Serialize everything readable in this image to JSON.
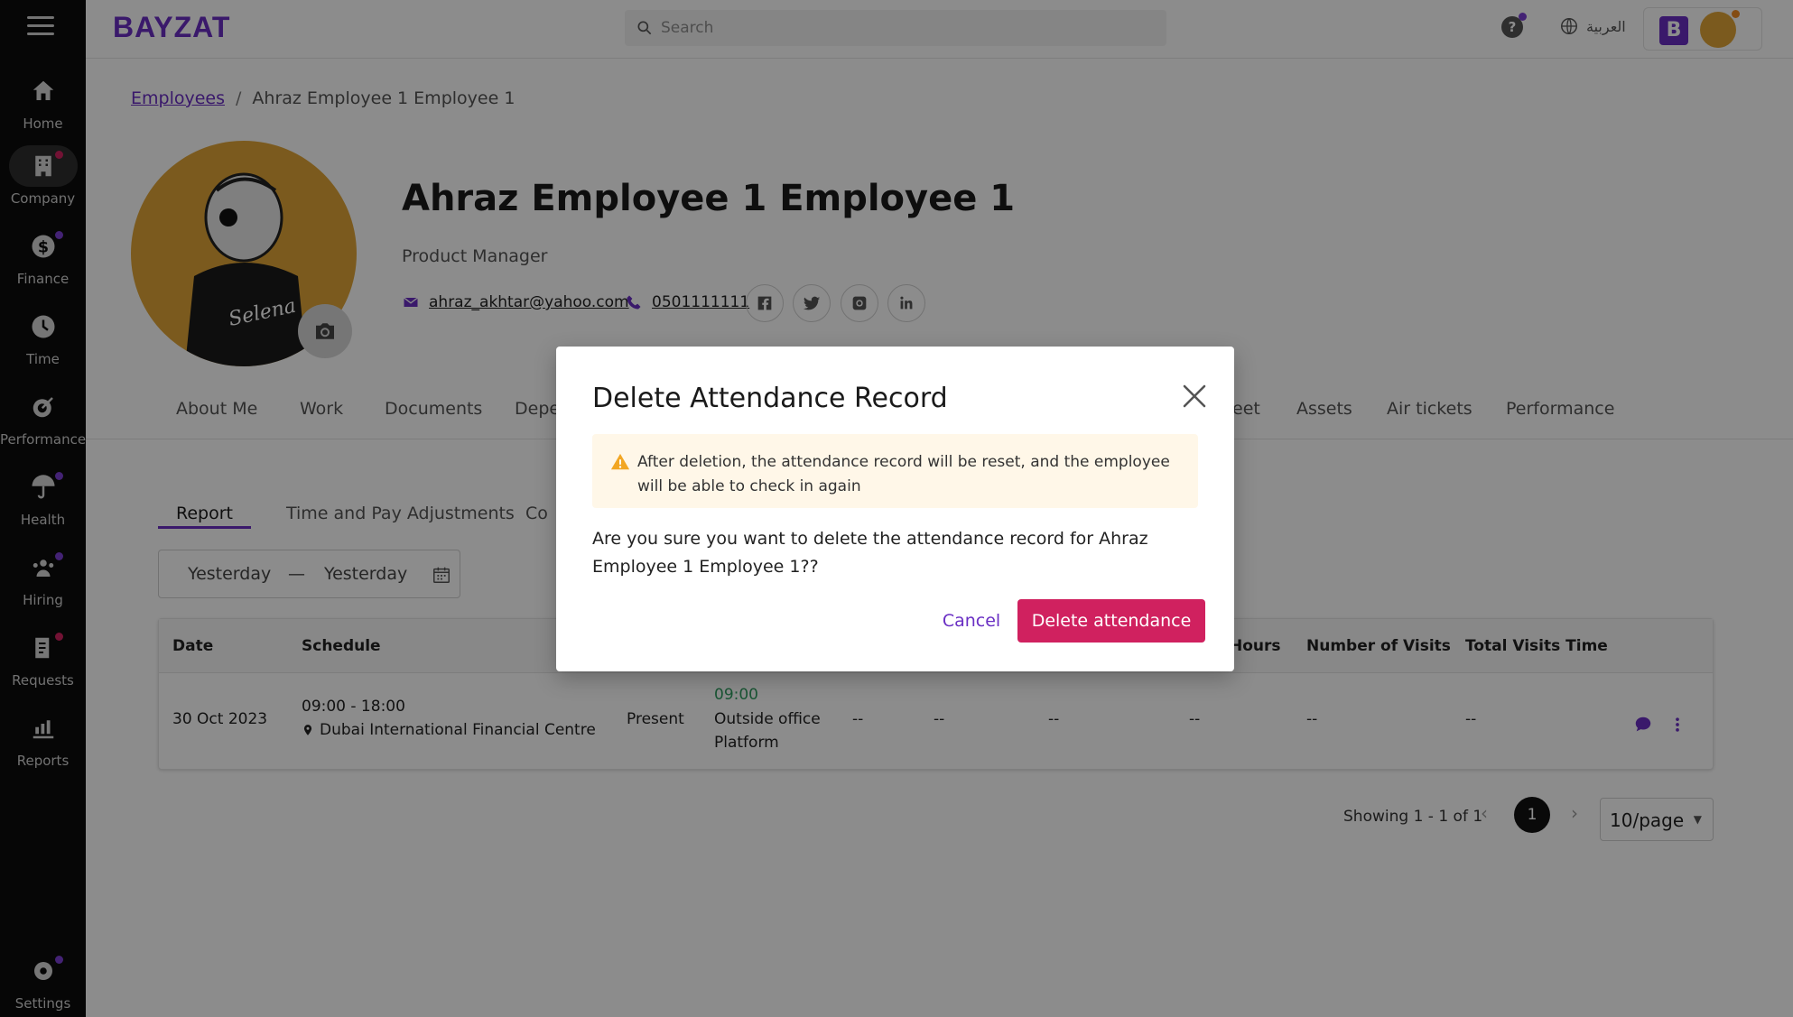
{
  "sidebar": {
    "items": [
      {
        "label": "Home",
        "icon": "home-icon",
        "dot": false
      },
      {
        "label": "Company",
        "icon": "building-icon",
        "dot": "red",
        "active": true
      },
      {
        "label": "Finance",
        "icon": "dollar-icon",
        "dot": "purple"
      },
      {
        "label": "Time",
        "icon": "clock-icon",
        "dot": false
      },
      {
        "label": "Performance",
        "icon": "target-icon",
        "dot": false
      },
      {
        "label": "Health",
        "icon": "umbrella-heart-icon",
        "dot": "purple"
      },
      {
        "label": "Hiring",
        "icon": "people-icon",
        "dot": "purple"
      },
      {
        "label": "Requests",
        "icon": "clipboard-icon",
        "dot": "red"
      },
      {
        "label": "Reports",
        "icon": "chart-icon",
        "dot": false
      }
    ],
    "settings_label": "Settings"
  },
  "topbar": {
    "logo": "BAYZAT",
    "search_placeholder": "Search",
    "language": "العربية",
    "account_initial": "B"
  },
  "breadcrumb": {
    "parent": "Employees",
    "current": "Ahraz Employee 1 Employee 1"
  },
  "profile": {
    "name": "Ahraz Employee 1 Employee 1",
    "title": "Product Manager",
    "email": "ahraz_akhtar@yahoo.com",
    "phone": "0501111111"
  },
  "tabs": [
    "About Me",
    "Work",
    "Documents",
    "Depe",
    "eet",
    "Assets",
    "Air tickets",
    "Performance"
  ],
  "subtabs": [
    "Report",
    "Time and Pay Adjustments",
    "Co"
  ],
  "daterange": {
    "from": "Yesterday",
    "separator": "—",
    "to": "Yesterday"
  },
  "table": {
    "headers": [
      "Date",
      "Schedule",
      "Hours",
      "Number of Visits",
      "Total Visits Time"
    ],
    "row": {
      "date": "30 Oct 2023",
      "schedule_time": "09:00 - 18:00",
      "schedule_location": "Dubai International Financial Centre",
      "status": "Present",
      "checkin_time": "09:00",
      "checkin_place_1": "Outside office",
      "checkin_place_2": "Platform",
      "c1": "--",
      "c2": "--",
      "c3": "--",
      "c4": "--",
      "c5": "--",
      "c6": "--"
    }
  },
  "pagination": {
    "showing": "Showing 1 - 1 of 1",
    "page": "1",
    "page_size": "10/page"
  },
  "modal": {
    "title": "Delete Attendance Record",
    "warning": "After deletion, the attendance record will be reset, and the employee will be able to check in again",
    "body": "Are you sure you want to delete the attendance record for Ahraz Employee 1 Employee 1??",
    "cancel": "Cancel",
    "confirm": "Delete attendance"
  },
  "colors": {
    "brand": "#6a2fc4",
    "danger": "#d0215f",
    "warning_bg": "#fff7e8"
  }
}
